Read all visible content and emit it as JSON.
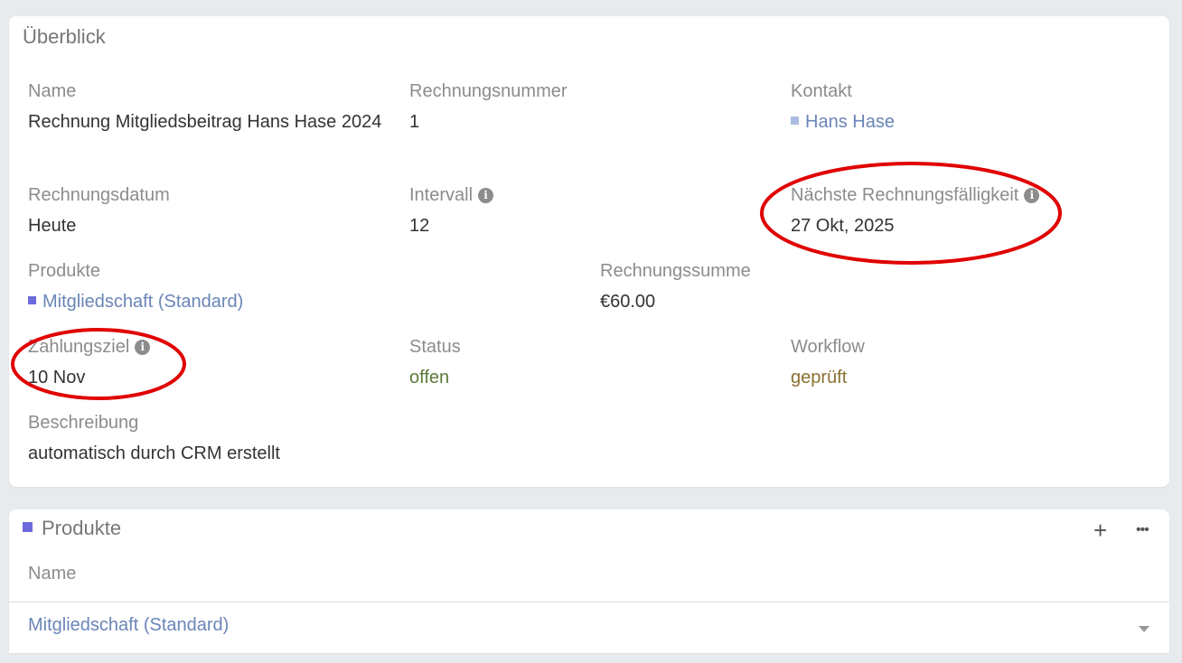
{
  "overview": {
    "title": "Überblick",
    "name": {
      "label": "Name",
      "value": "Rechnung Mitgliedsbeitrag Hans Hase 2024"
    },
    "invoice_number": {
      "label": "Rechnungsnummer",
      "value": "1"
    },
    "contact": {
      "label": "Kontakt",
      "value": "Hans Hase"
    },
    "invoice_date": {
      "label": "Rechnungsdatum",
      "value": "Heute"
    },
    "interval": {
      "label": "Intervall",
      "value": "12",
      "info_icon": "i"
    },
    "next_due": {
      "label": "Nächste Rechnungsfälligkeit",
      "value": "27 Okt, 2025",
      "info_icon": "i"
    },
    "products": {
      "label": "Produkte",
      "value": "Mitgliedschaft (Standard)"
    },
    "total": {
      "label": "Rechnungssumme",
      "value": "€60.00"
    },
    "payment_term": {
      "label": "Zahlungsziel",
      "value": "10 Nov",
      "info_icon": "i"
    },
    "status": {
      "label": "Status",
      "value": "offen"
    },
    "workflow": {
      "label": "Workflow",
      "value": "geprüft"
    },
    "description": {
      "label": "Beschreibung",
      "value": "automatisch durch CRM erstellt"
    }
  },
  "products_panel": {
    "title": "Produkte",
    "add_label": "+",
    "more_label": "•••",
    "column_name": "Name",
    "rows": [
      {
        "name": "Mitgliedschaft (Standard)"
      }
    ]
  },
  "colors": {
    "annotation": "#e00000",
    "link": "#6a85b8",
    "status_open": "#5c7a3a",
    "workflow_checked": "#8a7030",
    "product_square": "#6d6bdc",
    "contact_square": "#a9bde0"
  }
}
